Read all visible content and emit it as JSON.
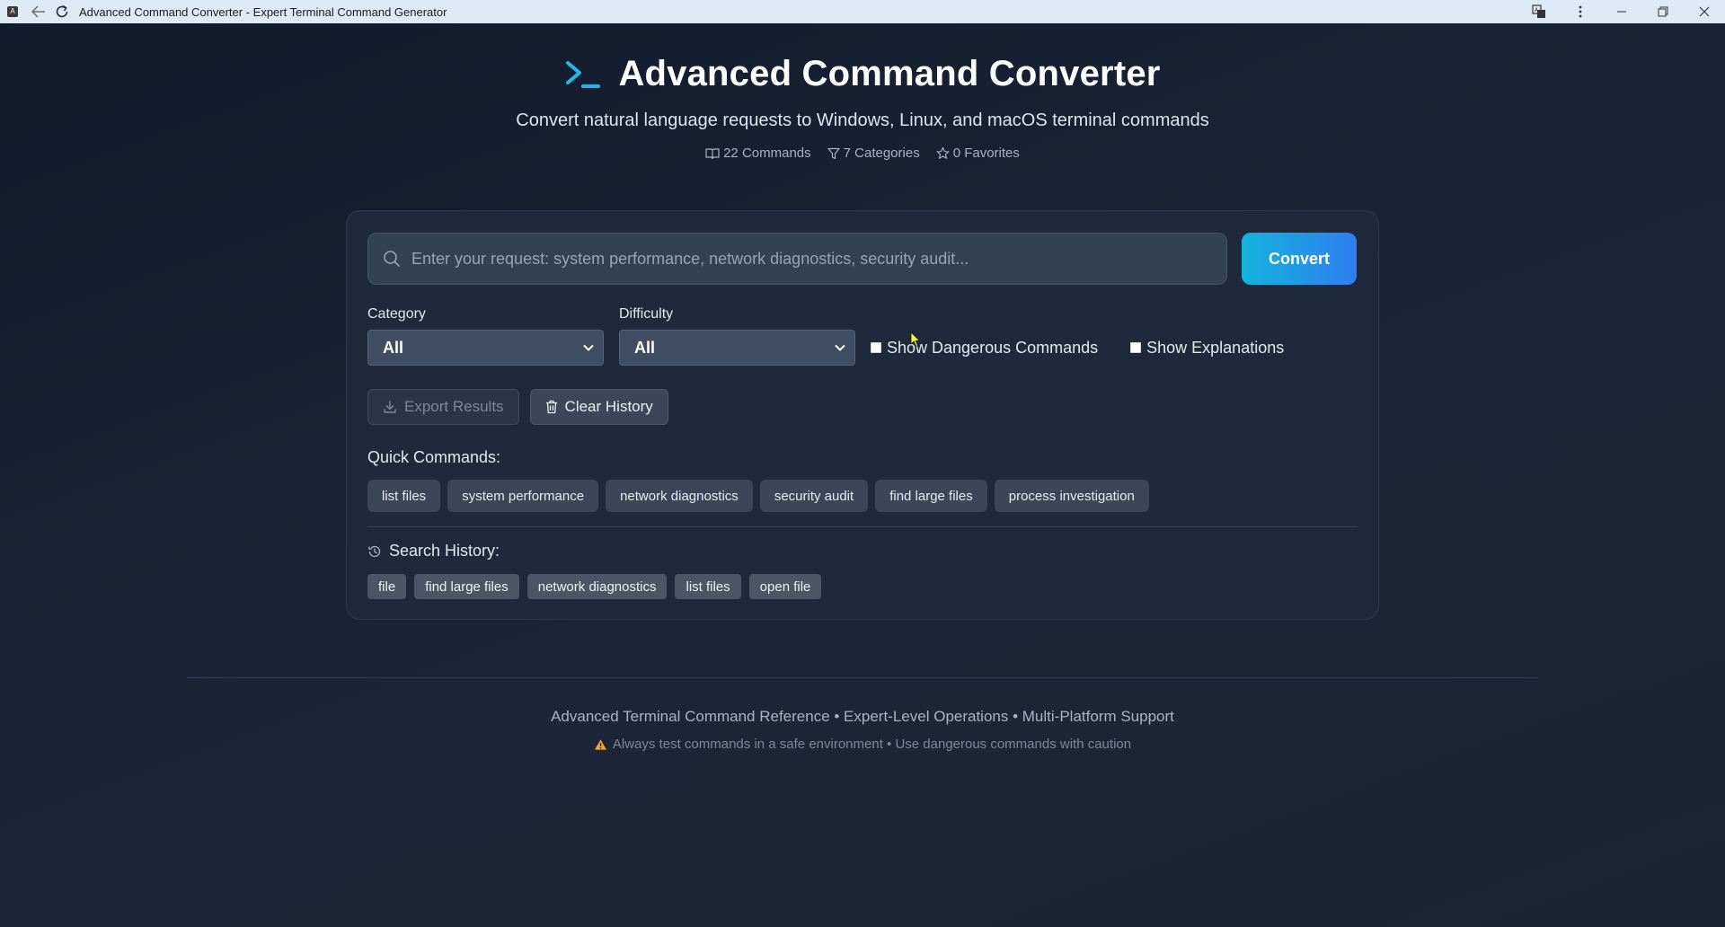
{
  "window": {
    "title": "Advanced Command Converter - Expert Terminal Command Generator",
    "app_icon_letter": "A"
  },
  "header": {
    "title": "Advanced Command Converter",
    "subtitle": "Convert natural language requests to Windows, Linux, and macOS terminal commands",
    "stats": {
      "commands": "22 Commands",
      "categories": "7 Categories",
      "favorites": "0 Favorites"
    }
  },
  "search": {
    "placeholder": "Enter your request: system performance, network diagnostics, security audit...",
    "value": "",
    "convert_label": "Convert"
  },
  "filters": {
    "category_label": "Category",
    "category_value": "All",
    "difficulty_label": "Difficulty",
    "difficulty_value": "All",
    "show_dangerous_label": "Show Dangerous Commands",
    "show_dangerous_checked": false,
    "show_explanations_label": "Show Explanations",
    "show_explanations_checked": false
  },
  "actions": {
    "export_label": "Export Results",
    "clear_label": "Clear History"
  },
  "quick": {
    "label": "Quick Commands:",
    "items": [
      "list files",
      "system performance",
      "network diagnostics",
      "security audit",
      "find large files",
      "process investigation"
    ]
  },
  "history": {
    "label": "Search History:",
    "items": [
      "file",
      "find large files",
      "network diagnostics",
      "list files",
      "open file"
    ]
  },
  "footer": {
    "main": "Advanced Terminal Command Reference • Expert-Level Operations • Multi-Platform Support",
    "warning": "Always test commands in a safe environment • Use dangerous commands with caution"
  },
  "colors": {
    "accent": "#22b8e6",
    "convert_gradient_start": "#14b3dd",
    "convert_gradient_end": "#2f7ef0",
    "warning": "#f5a524"
  }
}
